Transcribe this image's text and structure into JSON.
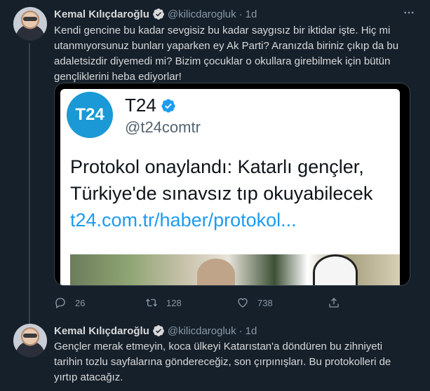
{
  "tweets": [
    {
      "author_name": "Kemal Kılıçdaroğlu",
      "handle": "@kilicdarogluk",
      "separator": "·",
      "time": "1d",
      "text_lines": [
        "Kendi gencine bu kadar sevgisiz bu kadar saygısız bir iktidar işte. Hiç mi",
        "utanmıyorsunuz bunları yaparken ey Ak Parti? Aranızda biriniz çıkıp da bu",
        "adaletsizdir diyemedi mi? Bizim çocuklar o okullara girebilmek için bütün",
        "gençliklerini heba ediyorlar!"
      ],
      "card": {
        "logo_text": "T24",
        "name": "T24",
        "handle": "@t24comtr",
        "headline_lines": [
          "Protokol onaylandı: Katarlı gençler,",
          "Türkiye'de sınavsız tıp okuyabilecek"
        ],
        "link": "t24.com.tr/haber/protokol..."
      },
      "actions": {
        "replies": "26",
        "retweets": "128",
        "likes": "738"
      }
    },
    {
      "author_name": "Kemal Kılıçdaroğlu",
      "handle": "@kilicdarogluk",
      "separator": "·",
      "time": "1d",
      "text_lines": [
        "Gençler merak etmeyin, koca ülkeyi Katarıstan'a döndüren bu zihniyeti",
        "tarihin tozlu sayfalarına göndereceğiz, son çırpınışları. Bu protokolleri de",
        "yırtıp atacağız."
      ]
    }
  ],
  "icons": {
    "more": "more-horizontal-icon",
    "verified": "verified-badge-icon",
    "reply": "reply-icon",
    "retweet": "retweet-icon",
    "like": "heart-icon",
    "share": "share-icon"
  },
  "colors": {
    "background": "#15202b",
    "text": "#d9d9d9",
    "muted": "#8899a6",
    "accent": "#1d9bf0",
    "t24_blue": "#1a99d6"
  }
}
